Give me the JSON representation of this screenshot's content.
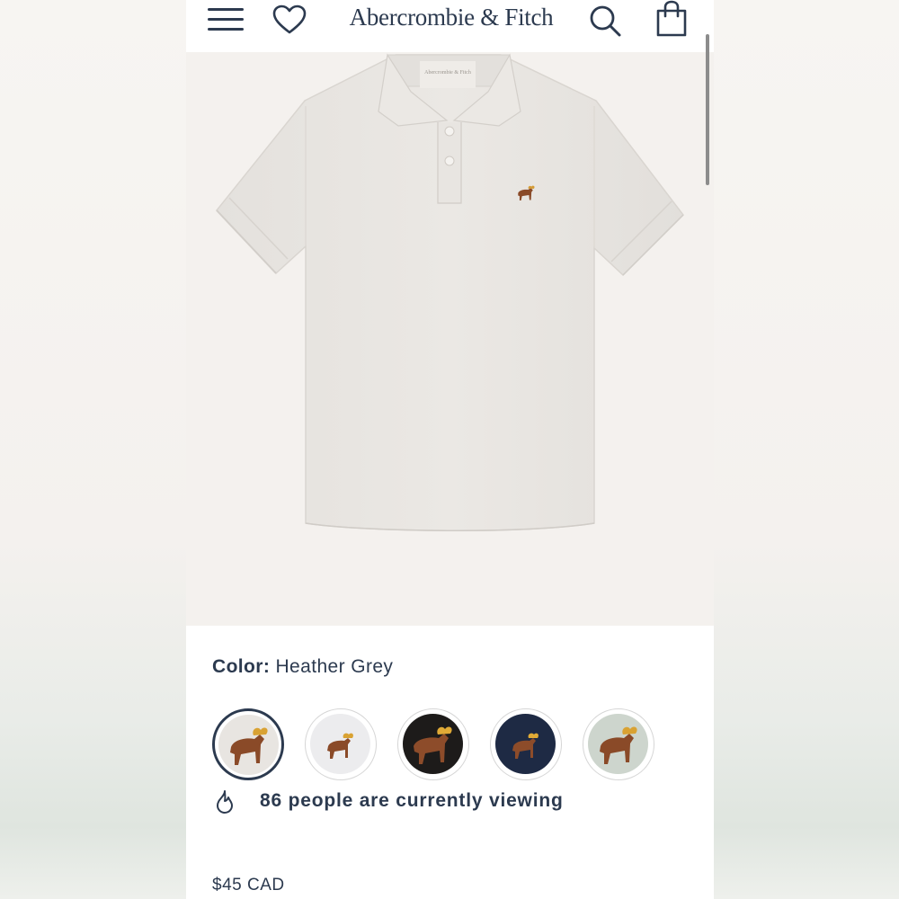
{
  "header": {
    "brand": "Abercrombie & Fitch",
    "icons": [
      "menu-icon",
      "heart-icon",
      "search-icon",
      "shopping-bag-icon"
    ]
  },
  "product": {
    "color_label": "Color:",
    "color_value": "Heather Grey",
    "swatches": [
      {
        "name": "Heather Grey",
        "color": "#e8e5e1",
        "selected": true
      },
      {
        "name": "White",
        "color": "#ececee",
        "selected": false
      },
      {
        "name": "Black",
        "color": "#1d1b1a",
        "selected": false
      },
      {
        "name": "Navy",
        "color": "#1e2a44",
        "selected": false
      },
      {
        "name": "Light Green",
        "color": "#cdd5cd",
        "selected": false
      }
    ],
    "viewing_text": "86 people are currently viewing",
    "price": "$45 CAD"
  },
  "colors": {
    "brand_navy": "#2c3a4f",
    "shirt": "#e9e6e2",
    "background": "#f4f1ee"
  }
}
